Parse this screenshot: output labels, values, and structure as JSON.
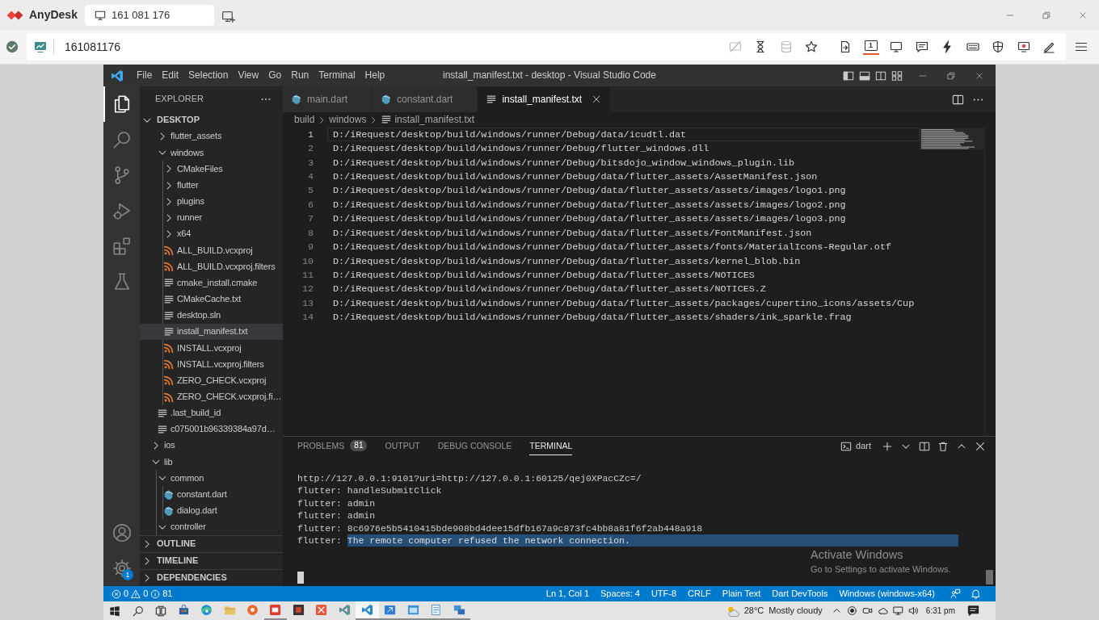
{
  "anydesk": {
    "app_name": "AnyDesk",
    "tabs": [
      {
        "label": "161 081 176",
        "selected": true
      }
    ],
    "address": "161081176",
    "toolbar_groups": [
      [
        {
          "kind": "privacy",
          "disabled": true,
          "selected": false
        },
        {
          "kind": "hourglass",
          "disabled": false,
          "selected": false
        },
        {
          "kind": "database",
          "disabled": true,
          "selected": false
        },
        {
          "kind": "star",
          "disabled": false,
          "selected": false
        }
      ],
      [
        {
          "kind": "file-transfer",
          "disabled": false,
          "selected": false
        },
        {
          "kind": "display",
          "label": "1",
          "disabled": false,
          "selected": true
        },
        {
          "kind": "monitor",
          "disabled": false,
          "selected": false
        },
        {
          "kind": "chat",
          "disabled": false,
          "selected": false
        },
        {
          "kind": "lightning",
          "disabled": false,
          "selected": false
        },
        {
          "kind": "keyboard",
          "disabled": false,
          "selected": false
        },
        {
          "kind": "shield",
          "disabled": false,
          "selected": false
        },
        {
          "kind": "record",
          "disabled": false,
          "selected": false
        },
        {
          "kind": "pen",
          "disabled": false,
          "selected": false
        }
      ]
    ]
  },
  "vscode": {
    "menu": [
      "File",
      "Edit",
      "Selection",
      "View",
      "Go",
      "Run",
      "Terminal",
      "Help"
    ],
    "title": "install_manifest.txt - desktop - Visual Studio Code",
    "activity_bar": [
      {
        "kind": "explorer",
        "selected": true
      },
      {
        "kind": "search",
        "selected": false
      },
      {
        "kind": "source-control",
        "selected": false
      },
      {
        "kind": "run-debug",
        "selected": false
      },
      {
        "kind": "extensions",
        "selected": false
      },
      {
        "kind": "testing",
        "selected": false
      }
    ],
    "settings_badge": "1",
    "sidebar": {
      "title": "EXPLORER",
      "folder": {
        "label": "DESKTOP",
        "expanded": true
      },
      "tree": [
        {
          "children": [
            {
              "label": "flutter_assets",
              "kind": "folder",
              "expanded": false,
              "selected": false
            },
            {
              "label": "windows",
              "kind": "folder",
              "expanded": true,
              "selected": false,
              "children": [
                {
                  "label": "CMakeFiles",
                  "kind": "folder",
                  "expanded": false,
                  "selected": false
                },
                {
                  "label": "flutter",
                  "kind": "folder",
                  "expanded": false,
                  "selected": false
                },
                {
                  "label": "plugins",
                  "kind": "folder",
                  "expanded": false,
                  "selected": false
                },
                {
                  "label": "runner",
                  "kind": "folder",
                  "expanded": false,
                  "selected": false
                },
                {
                  "label": "x64",
                  "kind": "folder",
                  "expanded": false,
                  "selected": false
                },
                {
                  "label": "ALL_BUILD.vcxproj",
                  "kind": "xml",
                  "selected": false
                },
                {
                  "label": "ALL_BUILD.vcxproj.filters",
                  "kind": "xml",
                  "selected": false
                },
                {
                  "label": "cmake_install.cmake",
                  "kind": "text",
                  "selected": false
                },
                {
                  "label": "CMakeCache.txt",
                  "kind": "text",
                  "selected": false
                },
                {
                  "label": "desktop.sln",
                  "kind": "text",
                  "selected": false
                },
                {
                  "label": "install_manifest.txt",
                  "kind": "text",
                  "selected": true
                },
                {
                  "label": "INSTALL.vcxproj",
                  "kind": "xml",
                  "selected": false
                },
                {
                  "label": "INSTALL.vcxproj.filters",
                  "kind": "xml",
                  "selected": false
                },
                {
                  "label": "ZERO_CHECK.vcxproj",
                  "kind": "xml",
                  "selected": false
                },
                {
                  "label": "ZERO_CHECK.vcxproj.fi…",
                  "kind": "xml",
                  "selected": false
                }
              ]
            },
            {
              "label": ".last_build_id",
              "kind": "text",
              "selected": false
            },
            {
              "label": "c075001b96339384a97d…",
              "kind": "text",
              "selected": false
            }
          ]
        },
        {
          "label": "ios",
          "kind": "folder",
          "expanded": false,
          "selected": false
        },
        {
          "label": "lib",
          "kind": "folder",
          "expanded": true,
          "selected": false,
          "children": [
            {
              "label": "common",
              "kind": "folder",
              "expanded": true,
              "selected": false,
              "children": [
                {
                  "label": "constant.dart",
                  "kind": "dart",
                  "selected": false
                },
                {
                  "label": "dialog.dart",
                  "kind": "dart",
                  "selected": false
                }
              ]
            },
            {
              "label": "controller",
              "kind": "folder",
              "expanded": true,
              "selected": false
            }
          ]
        }
      ],
      "sections": [
        {
          "label": "OUTLINE",
          "expanded": false
        },
        {
          "label": "TIMELINE",
          "expanded": false
        },
        {
          "label": "DEPENDENCIES",
          "expanded": false
        }
      ]
    },
    "tabs": [
      {
        "label": "main.dart",
        "kind": "dart",
        "selected": false
      },
      {
        "label": "constant.dart",
        "kind": "dart",
        "selected": false
      },
      {
        "label": "install_manifest.txt",
        "kind": "text",
        "selected": true
      }
    ],
    "breadcrumbs": [
      {
        "label": "build",
        "kind": "folder"
      },
      {
        "label": "windows",
        "kind": "folder"
      },
      {
        "label": "install_manifest.txt",
        "kind": "text"
      }
    ],
    "editor": {
      "lines": [
        {
          "number": "1",
          "text": "D:/iRequest/desktop/build/windows/runner/Debug/data/icudtl.dat",
          "current": true
        },
        {
          "number": "2",
          "text": "D:/iRequest/desktop/build/windows/runner/Debug/flutter_windows.dll",
          "current": false
        },
        {
          "number": "3",
          "text": "D:/iRequest/desktop/build/windows/runner/Debug/bitsdojo_window_windows_plugin.lib",
          "current": false
        },
        {
          "number": "4",
          "text": "D:/iRequest/desktop/build/windows/runner/Debug/data/flutter_assets/AssetManifest.json",
          "current": false
        },
        {
          "number": "5",
          "text": "D:/iRequest/desktop/build/windows/runner/Debug/data/flutter_assets/assets/images/logo1.png",
          "current": false
        },
        {
          "number": "6",
          "text": "D:/iRequest/desktop/build/windows/runner/Debug/data/flutter_assets/assets/images/logo2.png",
          "current": false
        },
        {
          "number": "7",
          "text": "D:/iRequest/desktop/build/windows/runner/Debug/data/flutter_assets/assets/images/logo3.png",
          "current": false
        },
        {
          "number": "8",
          "text": "D:/iRequest/desktop/build/windows/runner/Debug/data/flutter_assets/FontManifest.json",
          "current": false
        },
        {
          "number": "9",
          "text": "D:/iRequest/desktop/build/windows/runner/Debug/data/flutter_assets/fonts/MaterialIcons-Regular.otf",
          "current": false
        },
        {
          "number": "10",
          "text": "D:/iRequest/desktop/build/windows/runner/Debug/data/flutter_assets/kernel_blob.bin",
          "current": false
        },
        {
          "number": "11",
          "text": "D:/iRequest/desktop/build/windows/runner/Debug/data/flutter_assets/NOTICES",
          "current": false
        },
        {
          "number": "12",
          "text": "D:/iRequest/desktop/build/windows/runner/Debug/data/flutter_assets/NOTICES.Z",
          "current": false
        },
        {
          "number": "13",
          "text": "D:/iRequest/desktop/build/windows/runner/Debug/data/flutter_assets/packages/cupertino_icons/assets/Cup",
          "current": false
        },
        {
          "number": "14",
          "text": "D:/iRequest/desktop/build/windows/runner/Debug/data/flutter_assets/shaders/ink_sparkle.frag",
          "current": false
        }
      ]
    },
    "panel": {
      "tabs": [
        {
          "label": "PROBLEMS",
          "badge": "81",
          "selected": false
        },
        {
          "label": "OUTPUT",
          "selected": false
        },
        {
          "label": "DEBUG CONSOLE",
          "selected": false
        },
        {
          "label": "TERMINAL",
          "selected": true
        }
      ],
      "terminal_name": "dart",
      "terminal_lines": [
        {
          "text": "http://127.0.0.1:9101?uri=http://127.0.0.1:60125/qej0XPacCZc=/"
        },
        {
          "text": "flutter: handleSubmitClick"
        },
        {
          "text": "flutter: admin"
        },
        {
          "text": "flutter: admin"
        },
        {
          "text": "flutter: 8c6976e5b5410415bde908bd4dee15dfb167a9c873fc4bb8a81f6f2ab448a918"
        },
        {
          "text": "flutter:",
          "selected_text": "The remote computer refused the network connection."
        }
      ]
    },
    "status_bar": {
      "errors": "0",
      "warnings": "0",
      "infos": "81",
      "items": [
        "Ln 1, Col 1",
        "Spaces: 4",
        "UTF-8",
        "CRLF",
        "Plain Text",
        "Dart DevTools",
        "Windows (windows-x64)"
      ]
    }
  },
  "activation_notice": {
    "title": "Activate Windows",
    "message": "Go to Settings to activate Windows."
  },
  "taskbar": {
    "apps": [
      {
        "kind": "store",
        "selected": false,
        "running": false
      },
      {
        "kind": "browser",
        "selected": false,
        "running": false
      },
      {
        "kind": "files",
        "selected": false,
        "running": false
      },
      {
        "kind": "disc",
        "selected": false,
        "running": false
      },
      {
        "kind": "screen-tile",
        "selected": false,
        "running": true
      },
      {
        "kind": "square-tile",
        "selected": false,
        "running": false
      },
      {
        "kind": "cross-tile",
        "selected": false,
        "running": false
      },
      {
        "kind": "ribbon",
        "selected": false,
        "running": false
      },
      {
        "kind": "code-editor",
        "selected": true,
        "running": true
      },
      {
        "kind": "arrow-tile",
        "selected": false,
        "running": true
      },
      {
        "kind": "window-tile",
        "selected": false,
        "running": true
      },
      {
        "kind": "notepad",
        "selected": false,
        "running": true
      },
      {
        "kind": "screens",
        "selected": false,
        "running": true
      }
    ],
    "weather": {
      "temperature": "28°C",
      "condition": "Mostly cloudy"
    },
    "clock": "6:31 pm"
  }
}
